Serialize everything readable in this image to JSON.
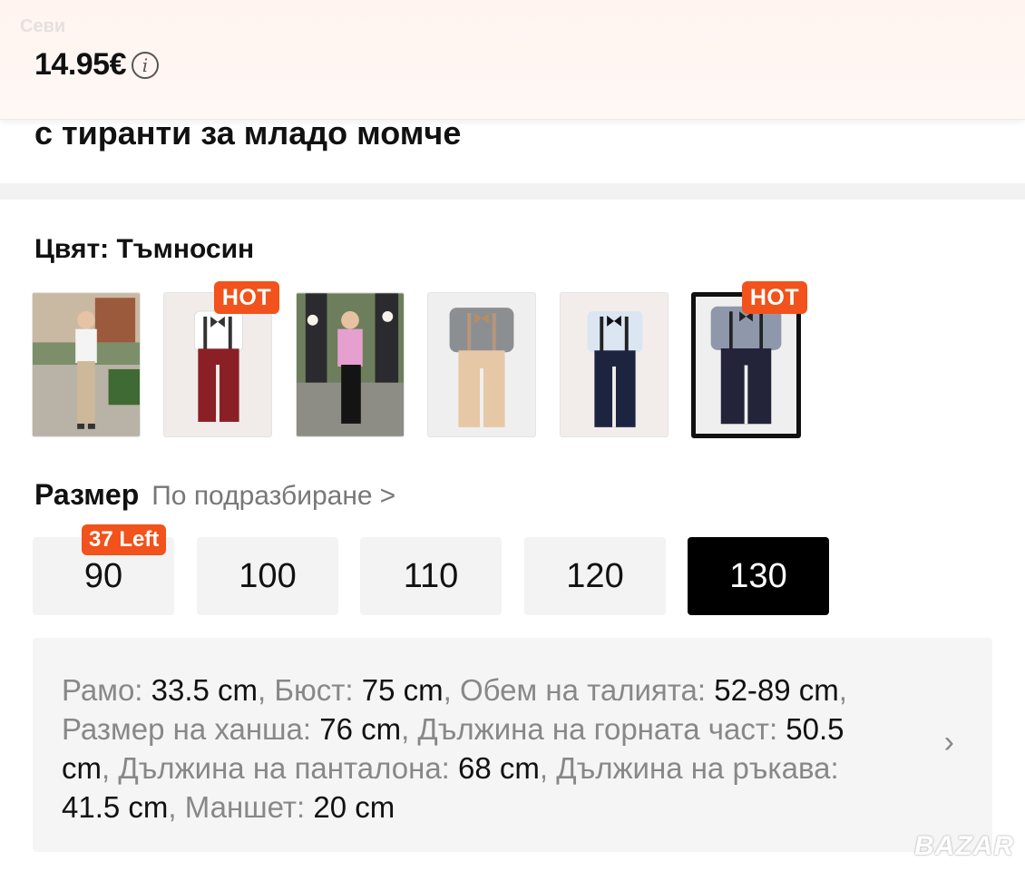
{
  "header": {
    "faded_label": "Севи",
    "price": "14.95€",
    "info_icon": "info-icon"
  },
  "product": {
    "title_tail": "с тиранти за младо момче"
  },
  "color": {
    "label": "Цвят: Тъмносин",
    "swatches": [
      {
        "name": "boy-beige-outdoor",
        "hot": false,
        "selected": false
      },
      {
        "name": "burgundy-pants",
        "hot": true,
        "hot_label": "HOT",
        "selected": false
      },
      {
        "name": "pink-shirt-wedding",
        "hot": false,
        "selected": false
      },
      {
        "name": "khaki-pants-grey-shirt",
        "hot": false,
        "selected": false
      },
      {
        "name": "navy-pants-light-shirt",
        "hot": false,
        "selected": false
      },
      {
        "name": "dark-navy-pants-grey-shirt",
        "hot": true,
        "hot_label": "HOT",
        "selected": true
      }
    ]
  },
  "size": {
    "label": "Размер",
    "default_label": "По подразбиране",
    "chevron": ">",
    "stock_badge": "37 Left",
    "options": [
      "90",
      "100",
      "110",
      "120",
      "130"
    ],
    "selected": "130"
  },
  "measurements": {
    "shoulder_label": "Рамо: ",
    "shoulder_value": "33.5 cm",
    "bust_label": ", Бюст: ",
    "bust_value": "75 cm",
    "waist_label": ", Обем на талията: ",
    "waist_value": "52-89 cm",
    "hip_label": ", Размер на ханша: ",
    "hip_value": "76 cm",
    "top_length_label": ", Дължина на горната част: ",
    "top_length_value": "50.5 cm",
    "pants_length_label": ", Дължина на панталона: ",
    "pants_length_value": "68 cm",
    "sleeve_label": ", Дължина на ръкава: ",
    "sleeve_value": "41.5 cm",
    "cuff_label": ", Маншет: ",
    "cuff_value": "20 cm",
    "chevron": "›"
  },
  "watermark": "BAZAR",
  "colors": {
    "accent": "#f2521b",
    "selected_bg": "#000000",
    "chip_bg": "#f3f3f3"
  }
}
